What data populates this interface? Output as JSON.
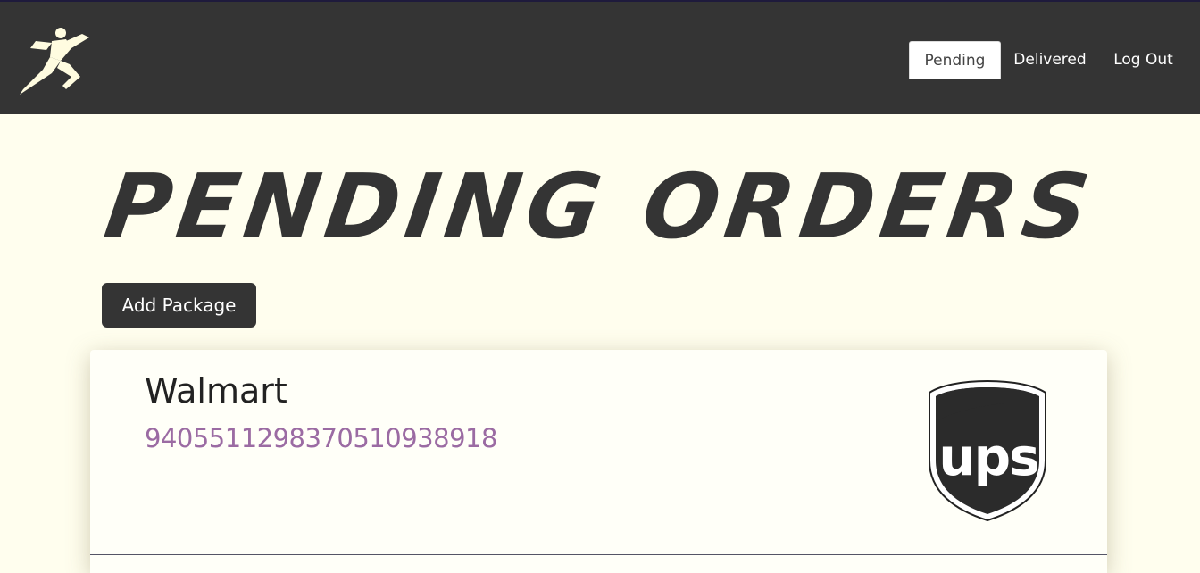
{
  "header": {
    "logo_icon": "running-figure-icon",
    "nav": {
      "tabs": [
        {
          "label": "Pending",
          "active": true
        },
        {
          "label": "Delivered",
          "active": false
        },
        {
          "label": "Log Out",
          "active": false
        }
      ]
    }
  },
  "main": {
    "title": "PENDING ORDERS",
    "add_button_label": "Add Package",
    "packages": [
      {
        "store": "Walmart",
        "tracking_number": "9405511298370510938918",
        "carrier": "ups",
        "carrier_icon": "ups-shield-icon"
      }
    ]
  },
  "colors": {
    "navbar": "#343434",
    "background": "#fffeee",
    "tracking_link": "#9b6ba3",
    "button": "#343434"
  }
}
